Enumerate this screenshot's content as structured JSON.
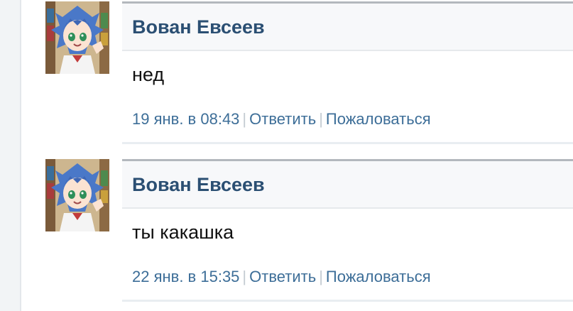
{
  "comments": [
    {
      "author": "Вован Евсеев",
      "text": "нед",
      "date": "19 янв. в 08:43",
      "reply_label": "Ответить",
      "report_label": "Пожаловаться",
      "separator": "|",
      "avatar": "anime-girl-avatar"
    },
    {
      "author": "Вован Евсеев",
      "text": "ты какашка",
      "date": "22 янв. в 15:35",
      "reply_label": "Ответить",
      "report_label": "Пожаловаться",
      "separator": "|",
      "avatar": "anime-girl-avatar"
    }
  ],
  "colors": {
    "author": "#2b4f73",
    "meta_link": "#3d6e98",
    "text": "#111111",
    "header_bg": "#f7f8fa",
    "header_border": "#b3b8bd"
  }
}
